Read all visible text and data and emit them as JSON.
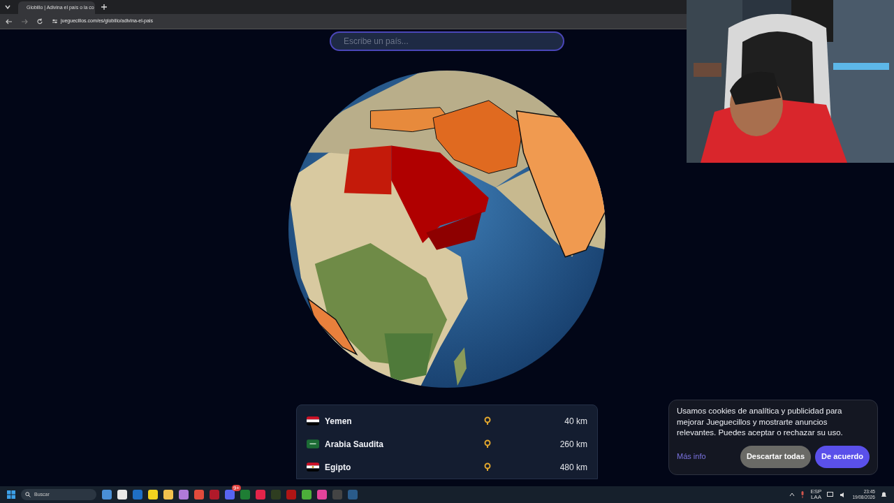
{
  "browser": {
    "tab_title": "Globillo | Adivina el país o la co",
    "url": "jueguecillos.com/es/globillo/adivina-el-pais"
  },
  "search": {
    "placeholder": "Escribe un país..."
  },
  "guesses": [
    {
      "country": "Yemen",
      "distance": "40 km",
      "kind": "yemen"
    },
    {
      "country": "Arabia Saudita",
      "distance": "260 km",
      "kind": "saudi"
    },
    {
      "country": "Egipto",
      "distance": "480 km",
      "kind": "egypt"
    }
  ],
  "cookie": {
    "text": "Usamos cookies de analítica y publicidad para mejorar Jueguecillos y mostrarte anuncios relevantes. Puedes aceptar o rechazar su uso.",
    "more_info": "Más info",
    "reject": "Descartar todas",
    "accept": "De acuerdo"
  },
  "taskbar": {
    "search": "Buscar",
    "badge": "9+",
    "language": "ESP",
    "region": "LAA",
    "time": "23:45",
    "date": "19/08/2026"
  }
}
